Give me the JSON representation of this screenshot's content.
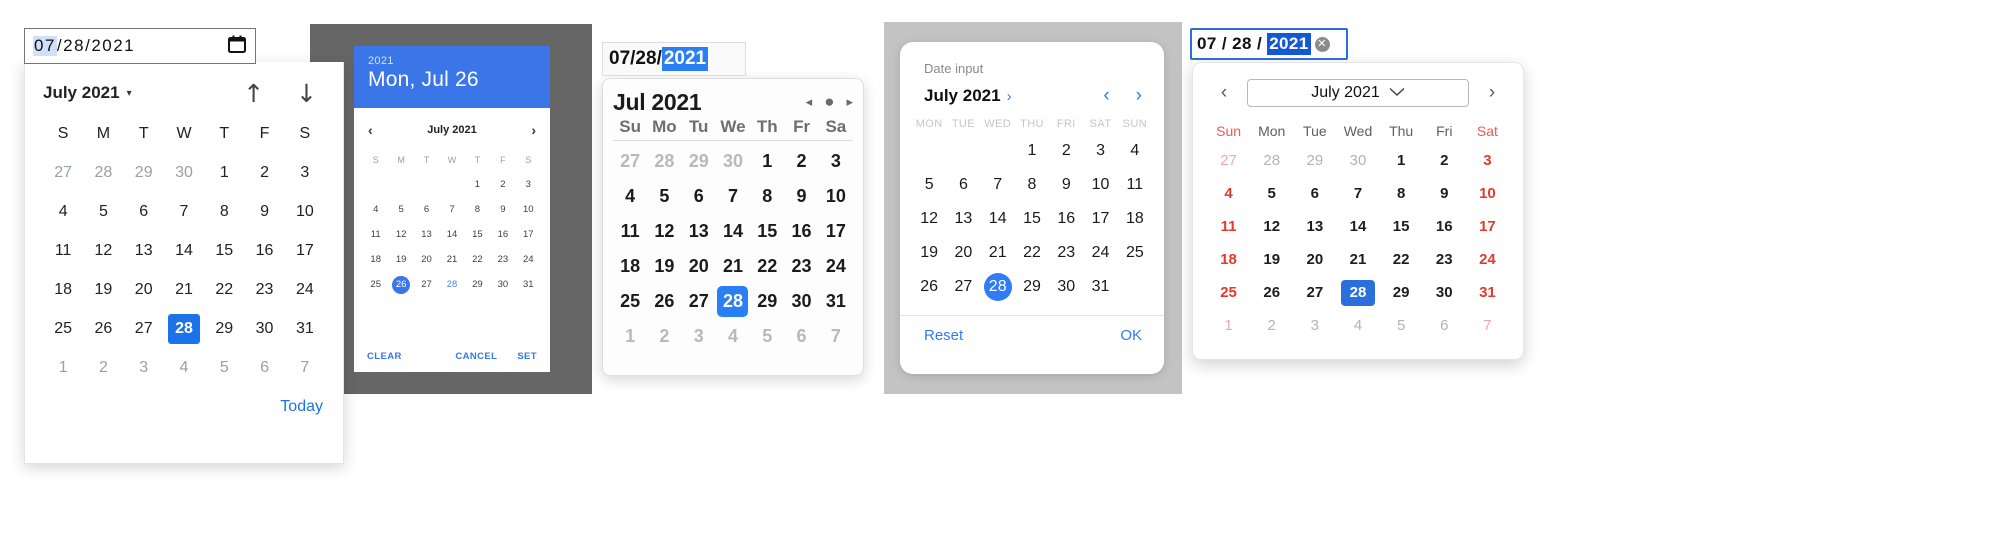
{
  "colors": {
    "accent_blue": "#1a73e8",
    "material_blue": "#3a76e8",
    "safari_blue": "#2b7ff5",
    "ios_blue": "#2f7cf6",
    "edge_blue": "#2b6fdc",
    "weekend_red": "#e23b2e",
    "dark_backdrop": "#666666",
    "light_backdrop": "#c3c3c3"
  },
  "picker_chrome": {
    "name": "chrome-date-picker",
    "input": {
      "month": "07",
      "day": "28",
      "year": "2021",
      "sep": "/",
      "selected_segment": "month",
      "icon": "calendar-icon"
    },
    "header": {
      "title": "July 2021",
      "caret": "▾",
      "prev_icon": "↑",
      "next_icon": "↓"
    },
    "dow": [
      "S",
      "M",
      "T",
      "W",
      "T",
      "F",
      "S"
    ],
    "weeks": [
      [
        {
          "d": "27",
          "o": true
        },
        {
          "d": "28",
          "o": true
        },
        {
          "d": "29",
          "o": true
        },
        {
          "d": "30",
          "o": true
        },
        {
          "d": "1"
        },
        {
          "d": "2"
        },
        {
          "d": "3"
        }
      ],
      [
        {
          "d": "4"
        },
        {
          "d": "5"
        },
        {
          "d": "6"
        },
        {
          "d": "7"
        },
        {
          "d": "8"
        },
        {
          "d": "9"
        },
        {
          "d": "10"
        }
      ],
      [
        {
          "d": "11"
        },
        {
          "d": "12"
        },
        {
          "d": "13"
        },
        {
          "d": "14"
        },
        {
          "d": "15"
        },
        {
          "d": "16"
        },
        {
          "d": "17"
        }
      ],
      [
        {
          "d": "18"
        },
        {
          "d": "19"
        },
        {
          "d": "20"
        },
        {
          "d": "21"
        },
        {
          "d": "22"
        },
        {
          "d": "23"
        },
        {
          "d": "24"
        }
      ],
      [
        {
          "d": "25"
        },
        {
          "d": "26"
        },
        {
          "d": "27"
        },
        {
          "d": "28",
          "s": true
        },
        {
          "d": "29"
        },
        {
          "d": "30"
        },
        {
          "d": "31"
        }
      ],
      [
        {
          "d": "1",
          "o": true
        },
        {
          "d": "2",
          "o": true
        },
        {
          "d": "3",
          "o": true
        },
        {
          "d": "4",
          "o": true
        },
        {
          "d": "5",
          "o": true
        },
        {
          "d": "6",
          "o": true
        },
        {
          "d": "7",
          "o": true
        }
      ]
    ],
    "footer": {
      "today_label": "Today"
    }
  },
  "picker_material": {
    "name": "material-date-picker",
    "head": {
      "year": "2021",
      "day_title": "Mon, Jul 26"
    },
    "nav": {
      "prev_icon": "‹",
      "title": "July 2021",
      "next_icon": "›"
    },
    "dow": [
      "S",
      "M",
      "T",
      "W",
      "T",
      "F",
      "S"
    ],
    "weeks": [
      [
        {
          "d": ""
        },
        {
          "d": ""
        },
        {
          "d": ""
        },
        {
          "d": ""
        },
        {
          "d": "1"
        },
        {
          "d": "2"
        },
        {
          "d": "3"
        }
      ],
      [
        {
          "d": "4"
        },
        {
          "d": "5"
        },
        {
          "d": "6"
        },
        {
          "d": "7"
        },
        {
          "d": "8"
        },
        {
          "d": "9"
        },
        {
          "d": "10"
        }
      ],
      [
        {
          "d": "11"
        },
        {
          "d": "12"
        },
        {
          "d": "13"
        },
        {
          "d": "14"
        },
        {
          "d": "15"
        },
        {
          "d": "16"
        },
        {
          "d": "17"
        }
      ],
      [
        {
          "d": "18"
        },
        {
          "d": "19"
        },
        {
          "d": "20"
        },
        {
          "d": "21"
        },
        {
          "d": "22"
        },
        {
          "d": "23"
        },
        {
          "d": "24"
        }
      ],
      [
        {
          "d": "25"
        },
        {
          "d": "26",
          "s": true
        },
        {
          "d": "27"
        },
        {
          "d": "28",
          "t": true
        },
        {
          "d": "29"
        },
        {
          "d": "30"
        },
        {
          "d": "31"
        }
      ]
    ],
    "buttons": {
      "clear": "CLEAR",
      "cancel": "CANCEL",
      "set": "SET"
    }
  },
  "picker_safari": {
    "name": "safari-date-picker",
    "input": {
      "month": "07",
      "day": "28",
      "year": "2021",
      "sep": "/",
      "selected_segment": "year"
    },
    "header": {
      "title": "Jul 2021",
      "prev_icon": "◂",
      "dot_icon": "●",
      "next_icon": "▸"
    },
    "dow": [
      "Su",
      "Mo",
      "Tu",
      "We",
      "Th",
      "Fr",
      "Sa"
    ],
    "weeks": [
      [
        {
          "d": "27",
          "o": true
        },
        {
          "d": "28",
          "o": true
        },
        {
          "d": "29",
          "o": true
        },
        {
          "d": "30",
          "o": true
        },
        {
          "d": "1"
        },
        {
          "d": "2"
        },
        {
          "d": "3"
        }
      ],
      [
        {
          "d": "4"
        },
        {
          "d": "5"
        },
        {
          "d": "6"
        },
        {
          "d": "7"
        },
        {
          "d": "8"
        },
        {
          "d": "9"
        },
        {
          "d": "10"
        }
      ],
      [
        {
          "d": "11"
        },
        {
          "d": "12"
        },
        {
          "d": "13"
        },
        {
          "d": "14"
        },
        {
          "d": "15"
        },
        {
          "d": "16"
        },
        {
          "d": "17"
        }
      ],
      [
        {
          "d": "18"
        },
        {
          "d": "19"
        },
        {
          "d": "20"
        },
        {
          "d": "21"
        },
        {
          "d": "22"
        },
        {
          "d": "23"
        },
        {
          "d": "24"
        }
      ],
      [
        {
          "d": "25"
        },
        {
          "d": "26"
        },
        {
          "d": "27"
        },
        {
          "d": "28",
          "s": true
        },
        {
          "d": "29"
        },
        {
          "d": "30"
        },
        {
          "d": "31"
        }
      ],
      [
        {
          "d": "1",
          "o": true
        },
        {
          "d": "2",
          "o": true
        },
        {
          "d": "3",
          "o": true
        },
        {
          "d": "4",
          "o": true
        },
        {
          "d": "5",
          "o": true
        },
        {
          "d": "6",
          "o": true
        },
        {
          "d": "7",
          "o": true
        }
      ]
    ]
  },
  "picker_ios": {
    "name": "ios-date-picker",
    "label": "Date input",
    "header": {
      "title": "July 2021",
      "expand_icon": "›",
      "prev_icon": "‹",
      "next_icon": "›"
    },
    "dow": [
      "MON",
      "TUE",
      "WED",
      "THU",
      "FRI",
      "SAT",
      "SUN"
    ],
    "weeks": [
      [
        {
          "d": ""
        },
        {
          "d": ""
        },
        {
          "d": ""
        },
        {
          "d": "1"
        },
        {
          "d": "2"
        },
        {
          "d": "3"
        },
        {
          "d": "4"
        }
      ],
      [
        {
          "d": "5"
        },
        {
          "d": "6"
        },
        {
          "d": "7"
        },
        {
          "d": "8"
        },
        {
          "d": "9"
        },
        {
          "d": "10"
        },
        {
          "d": "11"
        }
      ],
      [
        {
          "d": "12"
        },
        {
          "d": "13"
        },
        {
          "d": "14"
        },
        {
          "d": "15"
        },
        {
          "d": "16"
        },
        {
          "d": "17"
        },
        {
          "d": "18"
        }
      ],
      [
        {
          "d": "19"
        },
        {
          "d": "20"
        },
        {
          "d": "21"
        },
        {
          "d": "22"
        },
        {
          "d": "23"
        },
        {
          "d": "24"
        },
        {
          "d": "25"
        }
      ],
      [
        {
          "d": "26"
        },
        {
          "d": "27"
        },
        {
          "d": "28",
          "s": true
        },
        {
          "d": "29"
        },
        {
          "d": "30"
        },
        {
          "d": "31"
        },
        {
          "d": ""
        }
      ]
    ],
    "buttons": {
      "reset": "Reset",
      "ok": "OK"
    }
  },
  "picker_edge": {
    "name": "edge-date-picker",
    "input": {
      "month": "07",
      "day": "28",
      "year": "2021",
      "sep": "/",
      "selected_segment": "year",
      "clear_icon": "✕"
    },
    "header": {
      "prev_icon": "‹",
      "title": "July 2021",
      "dropdown_icon": "⌄",
      "next_icon": "›"
    },
    "dow": [
      "Sun",
      "Mon",
      "Tue",
      "Wed",
      "Thu",
      "Fri",
      "Sat"
    ],
    "weeks": [
      [
        {
          "d": "27",
          "o": true,
          "w": true
        },
        {
          "d": "28",
          "o": true
        },
        {
          "d": "29",
          "o": true
        },
        {
          "d": "30",
          "o": true
        },
        {
          "d": "1"
        },
        {
          "d": "2"
        },
        {
          "d": "3",
          "w": true
        }
      ],
      [
        {
          "d": "4",
          "w": true
        },
        {
          "d": "5"
        },
        {
          "d": "6"
        },
        {
          "d": "7"
        },
        {
          "d": "8"
        },
        {
          "d": "9"
        },
        {
          "d": "10",
          "w": true
        }
      ],
      [
        {
          "d": "11",
          "w": true
        },
        {
          "d": "12"
        },
        {
          "d": "13"
        },
        {
          "d": "14"
        },
        {
          "d": "15"
        },
        {
          "d": "16"
        },
        {
          "d": "17",
          "w": true
        }
      ],
      [
        {
          "d": "18",
          "w": true
        },
        {
          "d": "19"
        },
        {
          "d": "20"
        },
        {
          "d": "21"
        },
        {
          "d": "22"
        },
        {
          "d": "23"
        },
        {
          "d": "24",
          "w": true
        }
      ],
      [
        {
          "d": "25",
          "w": true
        },
        {
          "d": "26"
        },
        {
          "d": "27"
        },
        {
          "d": "28",
          "s": true
        },
        {
          "d": "29"
        },
        {
          "d": "30"
        },
        {
          "d": "31",
          "w": true
        }
      ],
      [
        {
          "d": "1",
          "o": true,
          "w": true
        },
        {
          "d": "2",
          "o": true
        },
        {
          "d": "3",
          "o": true
        },
        {
          "d": "4",
          "o": true
        },
        {
          "d": "5",
          "o": true
        },
        {
          "d": "6",
          "o": true
        },
        {
          "d": "7",
          "o": true,
          "w": true
        }
      ]
    ]
  }
}
